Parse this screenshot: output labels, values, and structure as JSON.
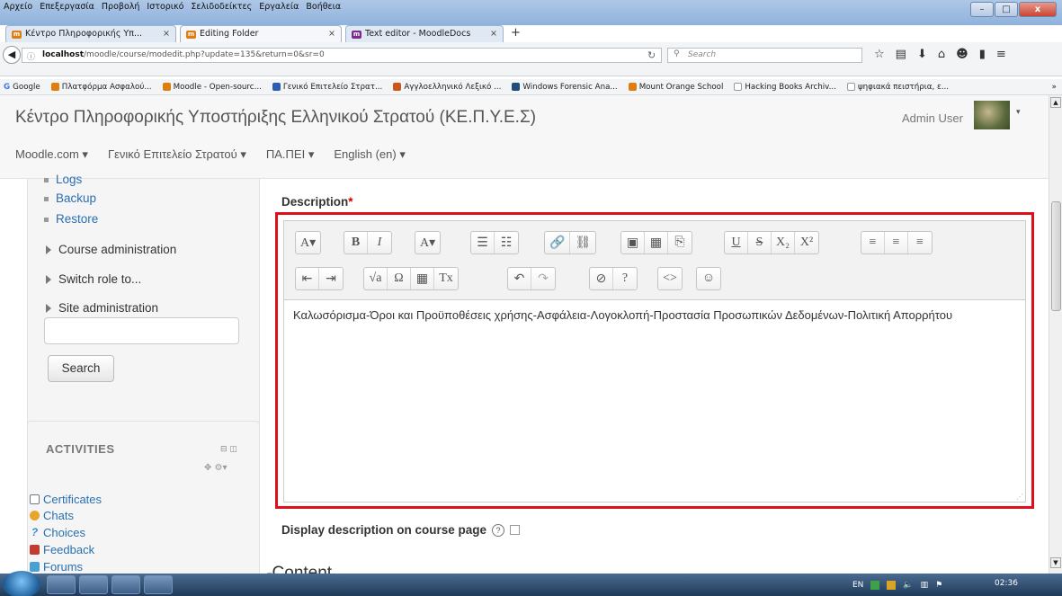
{
  "window": {
    "menu": [
      "Αρχείο",
      "Επεξεργασία",
      "Προβολή",
      "Ιστορικό",
      "Σελιδοδείκτες",
      "Εργαλεία",
      "Βοήθεια"
    ],
    "controls": {
      "minimize": "–",
      "maximize": "□",
      "close": "x"
    }
  },
  "tabs": [
    {
      "label": "Κέντρο Πληροφορικής Υπ...",
      "close": "×"
    },
    {
      "label": "Editing Folder",
      "close": "×"
    },
    {
      "label": "Text editor - MoodleDocs",
      "close": "×"
    }
  ],
  "newtab": "+",
  "address": {
    "host": "localhost",
    "rest": "/moodle/course/modedit.php?update=135&return=0&sr=0"
  },
  "search": {
    "placeholder": "Search"
  },
  "bookmarks": [
    "Google",
    "Πλατφόρμα Ασφαλού...",
    "Moodle - Open-sourc...",
    "Γενικό Επιτελείο Στρατ...",
    "Αγγλοελληνικό Λεξικό ...",
    "Windows Forensic Ana...",
    "Mount Orange School",
    "Hacking Books Archiv...",
    "ψηφιακά πειστήρια, ε..."
  ],
  "bookmarks_more": "»",
  "site": {
    "title": "Κέντρο Πληροφορικής Υποστήριξης Ελληνικού Στρατού (ΚΕ.Π.Υ.Ε.Σ)",
    "user": "Admin User",
    "menu": [
      "Moodle.com ▾",
      "Γενικό Επιτελείο Στρατού ▾",
      "ΠΑ.ΠΕΙ ▾",
      "English (en) ▾"
    ]
  },
  "sidebar": {
    "links": [
      "Logs",
      "Backup",
      "Restore"
    ],
    "nodes": [
      "Course administration",
      "Switch role to...",
      "Site administration"
    ],
    "search_button": "Search"
  },
  "activities": {
    "title": "ACTIVITIES",
    "items": [
      {
        "label": "Certificates",
        "color": "#6d7c8d"
      },
      {
        "label": "Chats",
        "color": "#e8a52b"
      },
      {
        "label": "Choices",
        "color": "#3b8ad3"
      },
      {
        "label": "Feedback",
        "color": "#c33b2e"
      },
      {
        "label": "Forums",
        "color": "#4aa0d5"
      }
    ]
  },
  "form": {
    "description_label": "Description",
    "required_mark": "*",
    "content": "Καλωσόρισμα-Όροι και Προϋποθέσεις χρήσης-Ασφάλεια-Λογοκλοπή-Προστασία Προσωπικών Δεδομένων-Πολιτική Απορρήτου",
    "display_desc_label": "Display description on course page",
    "help": "?",
    "content_section": "Content",
    "content_toggle": "▾"
  },
  "toolbar": {
    "row1": [
      [
        "A▾"
      ],
      [
        "B",
        "I"
      ],
      [
        "A▾"
      ],
      [
        "☰",
        "☷"
      ],
      [
        "🔗",
        "⛓"
      ],
      [
        "▣",
        "▦",
        "⎘"
      ],
      [
        "U",
        "S",
        "X₂",
        "X²"
      ],
      [
        "≡",
        "≡",
        "≡"
      ]
    ],
    "row2": [
      [
        "⇤",
        "⇥"
      ],
      [
        "√a",
        "Ω",
        "▦",
        "Tx"
      ],
      [
        "↶",
        "↷"
      ],
      [
        "⊘",
        "?"
      ],
      [
        "<>"
      ],
      [
        "☺"
      ]
    ]
  },
  "tray": {
    "lang": "EN",
    "time": "02:36"
  }
}
